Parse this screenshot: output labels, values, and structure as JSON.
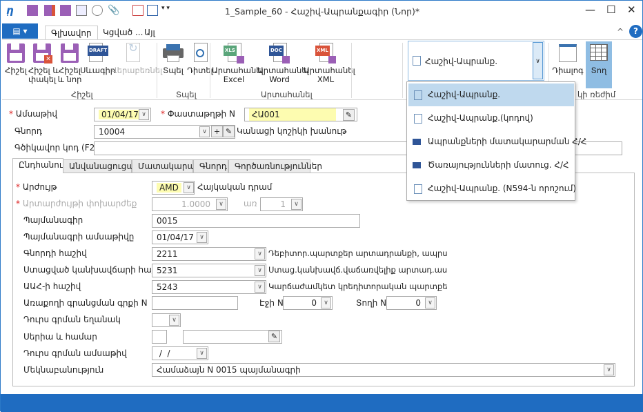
{
  "window": {
    "title": "1_Sample_60 - Հաշիվ-Ապրանքագիր (Նոր)*",
    "minimize": "—",
    "maximize": "☐",
    "close": "✕",
    "help": "?",
    "collapse": "^"
  },
  "ribbon": {
    "tabs": [
      {
        "label": "Գլխավոր",
        "active": true
      },
      {
        "label": "Կցված ..."
      },
      {
        "label": "Այլ"
      }
    ],
    "groups": {
      "save": {
        "label": "Հիշել",
        "buttons": [
          {
            "label": "Հիշել",
            "icon": "save-icon"
          },
          {
            "label": "Հիշել և\nփակել",
            "icon": "save-close-icon"
          },
          {
            "label": "Հիշել\nև նոր",
            "icon": "save-new-icon"
          },
          {
            "label": "Սևագիր",
            "icon": "draft-icon"
          },
          {
            "label": "Վերաբեռնել",
            "icon": "reload-icon",
            "disabled": true
          }
        ]
      },
      "print": {
        "label": "Տպել",
        "buttons": [
          {
            "label": "Տպել",
            "icon": "printer-icon"
          },
          {
            "label": "Դիտել",
            "icon": "preview-icon"
          }
        ]
      },
      "export": {
        "label": "Արտահանել",
        "buttons": [
          {
            "label": "Արտահանել\nExcel",
            "tag": "XLS",
            "color": "#5aa57a"
          },
          {
            "label": "Արտահանել\nWord",
            "tag": "DOC",
            "color": "#2f5597"
          },
          {
            "label": "Արտահանել\nXML",
            "tag": "XML",
            "color": "#d9533a"
          }
        ]
      },
      "view": {
        "selected": "Հաշիվ-Ապրանք.",
        "mode_label": "կի ռեժիմ",
        "buttons": [
          {
            "label": "Դիալոգ"
          },
          {
            "label": "Տող",
            "active": true
          }
        ]
      }
    }
  },
  "dropdown": {
    "items": [
      {
        "label": "Հաշիվ-Ապրանք.",
        "icon": "preview-icon",
        "selected": true
      },
      {
        "label": "Հաշիվ-Ապրանք.(կոդով)",
        "icon": "preview-icon"
      },
      {
        "label": "Ապրանքների մատակարարման Հ/Հ",
        "icon": "doc-icon"
      },
      {
        "label": "Ծառայությունների մատուց. Հ/Հ",
        "icon": "doc-icon"
      },
      {
        "label": "Հաշիվ-Ապրանք. (N594-ն որոշում)",
        "icon": "preview-icon"
      }
    ]
  },
  "header": {
    "date_label": "Ամսաթիվ",
    "date": "01/04/17",
    "docnum_label": "Փաստաթղթի N",
    "docnum": "ՀԱ001",
    "customer_label": "Գնորդ",
    "customer": "10004",
    "customer_name": "Կանացի կոշիկի խանութ",
    "barcode_label": "Գծիկավոր կոդ (F2)",
    "barcode": ""
  },
  "form_tabs": [
    "Ընդհանուր",
    "Անվանացուցակ",
    "Մատակարար",
    "Գնորդ",
    "Գործառնություններ"
  ],
  "general": {
    "currency_label": "Արժույթ",
    "currency": "AMD",
    "currency_name": "Հայկական դրամ",
    "rate_label": "Արտարժույթի փոխարժեք",
    "rate": "1.0000",
    "per_label": "առ",
    "per": "1",
    "contract_label": "Պայմանագիր",
    "contract": "0015",
    "contract_date_label": "Պայմանագրի ամսաթիվը",
    "contract_date": "01/04/17",
    "customer_acc_label": "Գնորդի հաշիվ",
    "customer_acc": "2211",
    "customer_acc_name": "Դեբիտոր.պարտքեր արտադրանքի, ապրս",
    "advance_acc_label": "Ստացված կանխավճարի հաշիվ",
    "advance_acc": "5231",
    "advance_acc_name": "Ստաց.կանխավճ.վաճառվելիք արտադ.աս",
    "vat_acc_label": "ԱԱՀ-ի հաշիվ",
    "vat_acc": "5243",
    "vat_acc_name": "Կարճաժամկետ կրեդիտորական պարտքե",
    "sales_book_label": "Առաքողի գրանցման գրքի N",
    "sales_book": "",
    "page_label": "Էջի N",
    "page": "0",
    "row_label": "Տողի N",
    "row": "0",
    "issue_method_label": "Դուրս գրման եղանակ",
    "issue_method": "",
    "series_label": "Սերիա և համար",
    "series": "",
    "number": "",
    "issue_date_label": "Դուրս գրման ամսաթիվ",
    "issue_date": " /  /",
    "comment_label": "Մեկնաբանություն",
    "comment": "Համաձայն N 0015 պայմանագրի"
  }
}
